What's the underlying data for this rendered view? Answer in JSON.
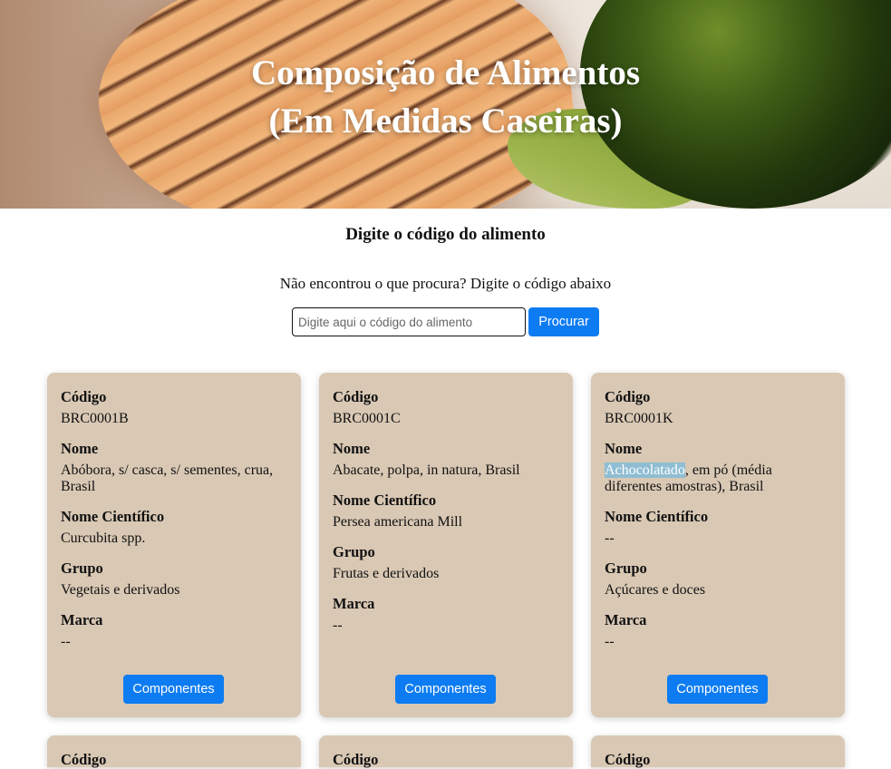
{
  "header": {
    "title_line1": "Composição de Alimentos",
    "title_line2": "(Em Medidas Caseiras)"
  },
  "search_section": {
    "title": "Digite o código do alimento",
    "hint": "Não encontrou o que procura? Digite o código abaixo",
    "input_placeholder": "Digite aqui o código do alimento",
    "input_value": "",
    "button_label": "Procurar"
  },
  "labels": {
    "code": "Código",
    "name": "Nome",
    "scientific_name": "Nome Científico",
    "group": "Grupo",
    "brand": "Marca"
  },
  "cards": [
    {
      "code": "BRC0001B",
      "name": "Abóbora, s/ casca, s/ sementes, crua, Brasil",
      "scientific_name": "Curcubita spp.",
      "group": "Vegetais e derivados",
      "brand": "--",
      "button_label": "Componentes"
    },
    {
      "code": "BRC0001C",
      "name": "Abacate, polpa, in natura, Brasil",
      "scientific_name": "Persea americana Mill",
      "group": "Frutas e derivados",
      "brand": "--",
      "button_label": "Componentes"
    },
    {
      "code": "BRC0001K",
      "name_highlight": "Achocolatado",
      "name_rest": ", em pó (média diferentes amostras), Brasil",
      "scientific_name": "--",
      "group": "Açúcares e doces",
      "brand": "--",
      "button_label": "Componentes"
    }
  ],
  "next_row_partial": {
    "code_label": "Código"
  },
  "colors": {
    "card_background": "#d9c8b4",
    "button_blue": "#0d7cf2",
    "highlight": "#8fbdd3"
  }
}
